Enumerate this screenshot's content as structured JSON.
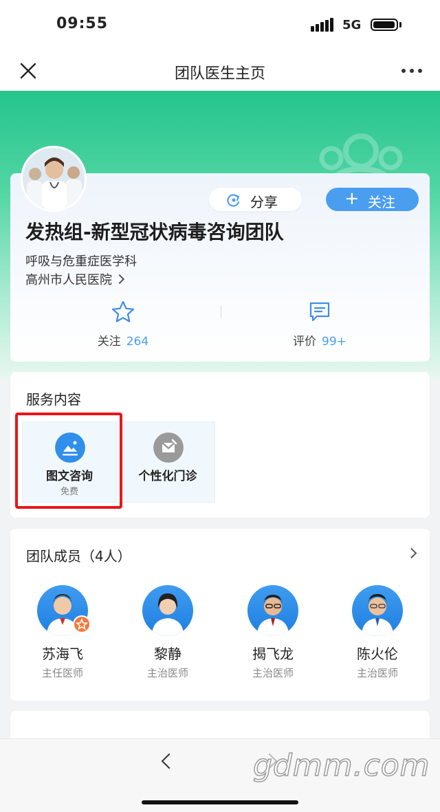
{
  "status_bar": {
    "time": "09:55",
    "network": "5G"
  },
  "nav": {
    "title": "团队医生主页"
  },
  "profile": {
    "share_label": "分享",
    "follow_label": "关注",
    "team_name": "发热组-新型冠状病毒咨询团队",
    "department": "呼吸与危重症医学科",
    "hospital": "高州市人民医院",
    "stats": [
      {
        "label": "关注",
        "value": "264",
        "icon": "star-icon"
      },
      {
        "label": "评价",
        "value": "99+",
        "icon": "message-icon"
      }
    ]
  },
  "services": {
    "title": "服务内容",
    "items": [
      {
        "name": "图文咨询",
        "sub": "免费",
        "icon": "image-text-icon",
        "color": "#2f8fea"
      },
      {
        "name": "个性化门诊",
        "sub": "",
        "icon": "clinic-icon",
        "color": "#9a9a9a"
      }
    ]
  },
  "team": {
    "title": "团队成员（4人）",
    "members": [
      {
        "name": "苏海飞",
        "title": "主任医师",
        "leader": true
      },
      {
        "name": "黎静",
        "title": "主治医师"
      },
      {
        "name": "揭飞龙",
        "title": "主治医师"
      },
      {
        "name": "陈火伦",
        "title": "主治医师"
      }
    ]
  },
  "watermark": "gdmm.com",
  "colors": {
    "brand_green": "#25c48d",
    "accent_blue": "#4a9ef0",
    "highlight_red": "#e8161b"
  }
}
